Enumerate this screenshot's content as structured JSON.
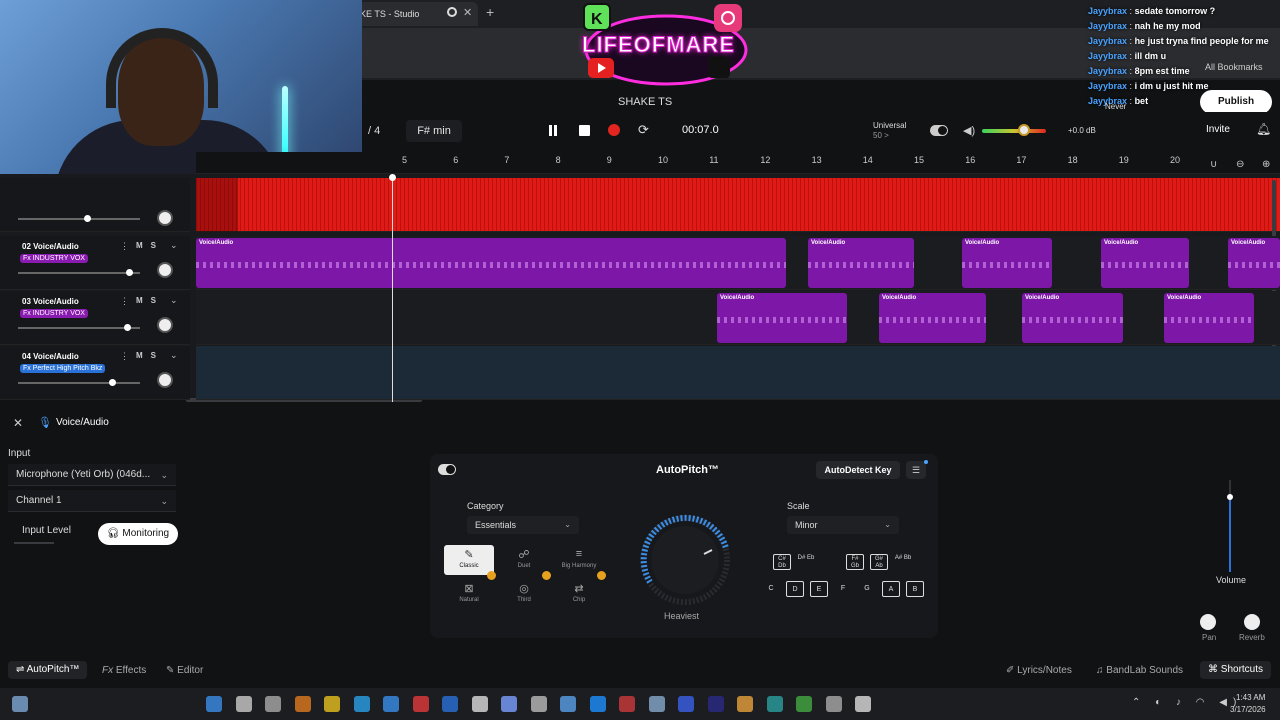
{
  "browser": {
    "tab_title": "KE TS - Studio",
    "tab_close": "✕",
    "new_tab": "+",
    "bookmarks_label": "All Bookmarks"
  },
  "overlay": {
    "logo_text": "LIFEOFMARE",
    "chat": [
      {
        "user": "Jayybrax",
        "msg": "sedate tomorrow ?"
      },
      {
        "user": "Jayybrax",
        "msg": "nah he my mod"
      },
      {
        "user": "Jayybrax",
        "msg": "he just tryna find people for me"
      },
      {
        "user": "Jayybrax",
        "msg": "ill dm u"
      },
      {
        "user": "Jayybrax",
        "msg": "8pm est time"
      },
      {
        "user": "Jayybrax",
        "msg": "i dm u just hit me"
      },
      {
        "user": "Jayybrax",
        "msg": "bet"
      }
    ]
  },
  "header": {
    "project_title": "SHAKE TS",
    "publish_label": "Publish",
    "never_label": "Never"
  },
  "transport": {
    "time_signature": "/ 4",
    "key": "F# min",
    "time": "00:07.0",
    "universal_label": "Universal",
    "universal_sub": "50 >",
    "gain": "+0.0 dB",
    "invite": "Invite",
    "notification_count": "1"
  },
  "ruler": [
    "5",
    "6",
    "7",
    "8",
    "9",
    "10",
    "11",
    "12",
    "13",
    "14",
    "15",
    "16",
    "17",
    "18",
    "19",
    "20"
  ],
  "tracks": [
    {
      "name": "02 Voice/Audio",
      "fx": "Fx INDUSTRY VOX",
      "fx_color": "#8a1bb0",
      "volume": 0.92
    },
    {
      "name": "03 Voice/Audio",
      "fx": "Fx INDUSTRY VOX",
      "fx_color": "#8a1bb0",
      "volume": 0.9
    },
    {
      "name": "04 Voice/Audio",
      "fx": "Fx Perfect High Pitch Bkz",
      "fx_color": "#2a72d8",
      "volume": 0.78
    }
  ],
  "track_controls": {
    "mute": "M",
    "solo": "S"
  },
  "clip_label": "Voice/Audio",
  "inspector": {
    "title": "Voice/Audio",
    "input_label": "Input",
    "input_device": "Microphone (Yeti Orb) (046d...",
    "channel": "Channel 1",
    "input_level_label": "Input Level",
    "monitoring_label": "Monitoring"
  },
  "autopitch": {
    "title": "AutoPitch™",
    "autodetect_label": "AutoDetect Key",
    "category_label": "Category",
    "category_value": "Essentials",
    "scale_label": "Scale",
    "scale_value": "Minor",
    "dial_label": "Heaviest",
    "presets": [
      "Classic",
      "Duet",
      "Big Harmony",
      "Natural",
      "Third",
      "Chip"
    ],
    "sharp_keys": [
      "C# Db",
      "D# Eb",
      "F# Gb",
      "G# Ab",
      "A# Bb"
    ],
    "natural_keys": [
      "C",
      "D",
      "E",
      "F",
      "G",
      "A",
      "B"
    ]
  },
  "mixer": {
    "volume_label": "Volume",
    "pan_label": "Pan",
    "reverb_label": "Reverb"
  },
  "bottom_tabs": {
    "autopitch": "AutoPitch™",
    "effects": "Effects",
    "editor": "Editor",
    "lyrics": "Lyrics/Notes",
    "sounds": "BandLab Sounds",
    "shortcuts": "Shortcuts"
  },
  "taskbar": {
    "time": "1:43 AM",
    "date": "3/17/2026"
  }
}
